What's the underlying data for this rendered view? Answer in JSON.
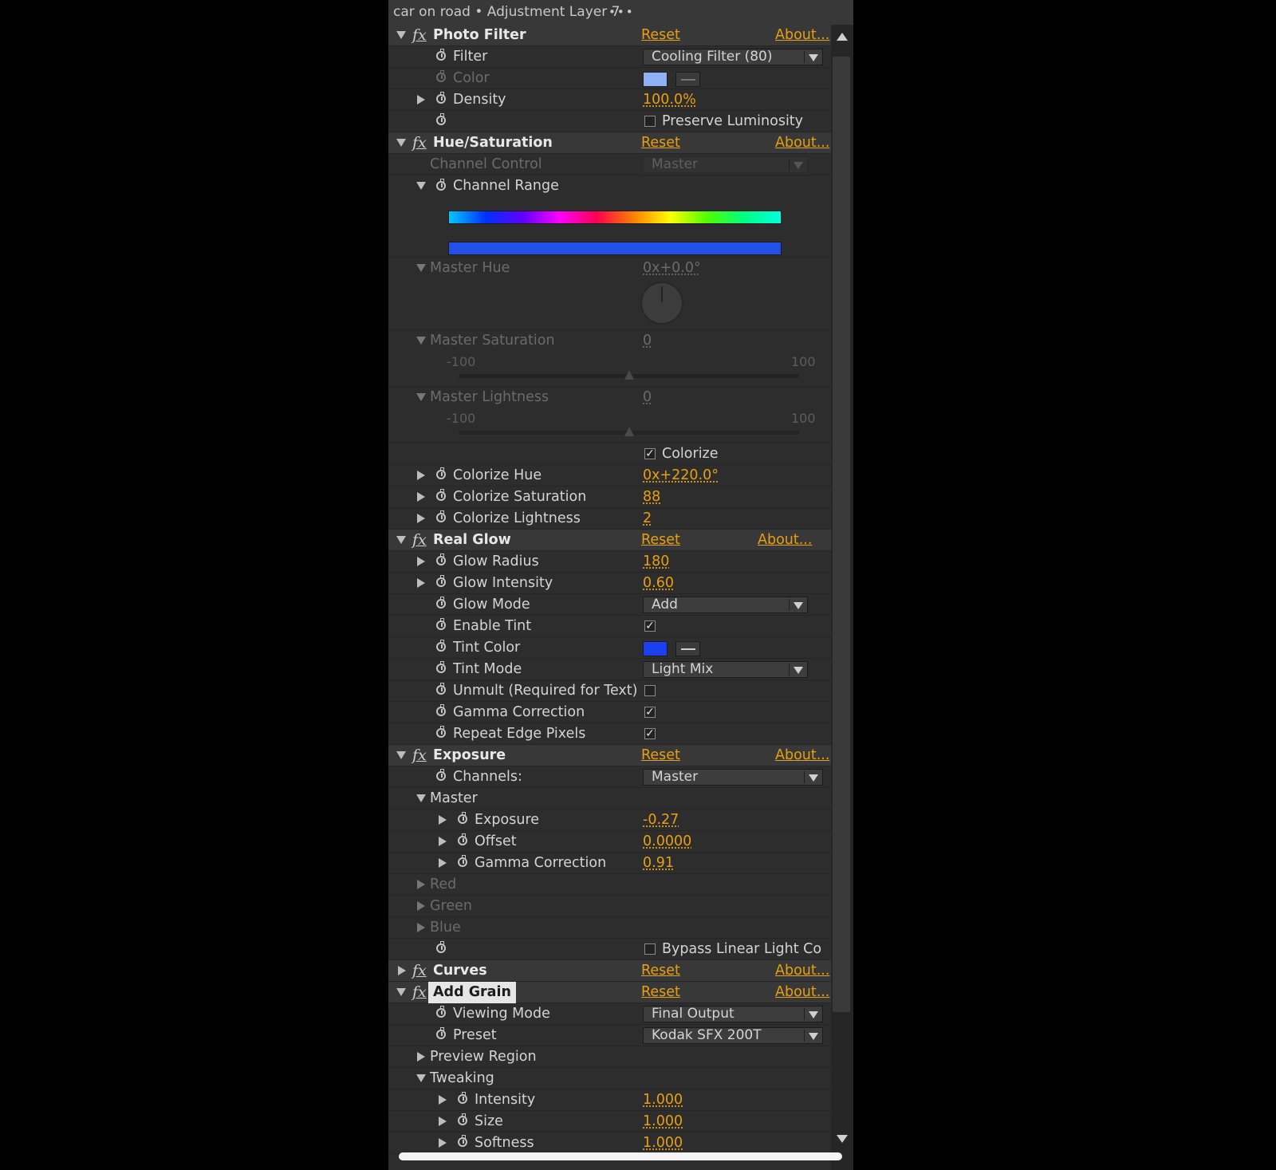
{
  "window": {
    "title": "car on road • Adjustment Layer 7",
    "menu_glyph": "•••"
  },
  "effects": {
    "photo_filter": {
      "name": "Photo Filter",
      "reset": "Reset",
      "about": "About...",
      "filter": {
        "label": "Filter",
        "value": "Cooling Filter (80)"
      },
      "color": {
        "label": "Color",
        "swatch": "#8fb0f5"
      },
      "density": {
        "label": "Density",
        "value": "100.0%"
      },
      "preserve": {
        "label": "Preserve Luminosity",
        "checked": false
      }
    },
    "hue_saturation": {
      "name": "Hue/Saturation",
      "reset": "Reset",
      "about": "About...",
      "channel_control": {
        "label": "Channel Control",
        "value": "Master"
      },
      "channel_range": {
        "label": "Channel Range"
      },
      "master_hue": {
        "label": "Master Hue",
        "value": "0x+0.0°"
      },
      "master_saturation": {
        "label": "Master Saturation",
        "value": "0",
        "min": "-100",
        "max": "100",
        "level": 0
      },
      "master_lightness": {
        "label": "Master Lightness",
        "value": "0",
        "min": "-100",
        "max": "100",
        "level": 0
      },
      "colorize": {
        "label": "Colorize",
        "checked": true
      },
      "colorize_hue": {
        "label": "Colorize Hue",
        "value": "0x+220.0°"
      },
      "colorize_saturation": {
        "label": "Colorize Saturation",
        "value": "88"
      },
      "colorize_lightness": {
        "label": "Colorize Lightness",
        "value": "2"
      }
    },
    "real_glow": {
      "name": "Real Glow",
      "reset": "Reset",
      "about": "About...",
      "glow_radius": {
        "label": "Glow Radius",
        "value": "180"
      },
      "glow_intensity": {
        "label": "Glow Intensity",
        "value": "0.60"
      },
      "glow_mode": {
        "label": "Glow Mode",
        "value": "Add"
      },
      "enable_tint": {
        "label": "Enable Tint",
        "checked": true
      },
      "tint_color": {
        "label": "Tint Color",
        "swatch": "#1c3ff0"
      },
      "tint_mode": {
        "label": "Tint Mode",
        "value": "Light Mix"
      },
      "unmult": {
        "label": "Unmult (Required for Text)",
        "checked": false
      },
      "gamma_correction": {
        "label": "Gamma Correction",
        "checked": true
      },
      "repeat_edge": {
        "label": "Repeat Edge Pixels",
        "checked": true
      }
    },
    "exposure": {
      "name": "Exposure",
      "reset": "Reset",
      "about": "About...",
      "channels": {
        "label": "Channels:",
        "value": "Master"
      },
      "master": {
        "label": "Master"
      },
      "exposure": {
        "label": "Exposure",
        "value": "-0.27"
      },
      "offset": {
        "label": "Offset",
        "value": "0.0000"
      },
      "gamma": {
        "label": "Gamma Correction",
        "value": "0.91"
      },
      "red": {
        "label": "Red"
      },
      "green": {
        "label": "Green"
      },
      "blue": {
        "label": "Blue"
      },
      "bypass": {
        "label": "Bypass Linear Light Co",
        "checked": false
      }
    },
    "curves": {
      "name": "Curves",
      "reset": "Reset",
      "about": "About..."
    },
    "add_grain": {
      "name": "Add Grain",
      "reset": "Reset",
      "about": "About...",
      "viewing_mode": {
        "label": "Viewing Mode",
        "value": "Final Output"
      },
      "preset": {
        "label": "Preset",
        "value": "Kodak SFX 200T"
      },
      "preview_region": {
        "label": "Preview Region"
      },
      "tweaking": {
        "label": "Tweaking"
      },
      "intensity": {
        "label": "Intensity",
        "value": "1.000"
      },
      "size": {
        "label": "Size",
        "value": "1.000"
      },
      "softness": {
        "label": "Softness",
        "value": "1.000"
      }
    }
  },
  "colors": {
    "accent": "#e8a012",
    "panel": "#2d2d2d",
    "header": "#383838"
  }
}
